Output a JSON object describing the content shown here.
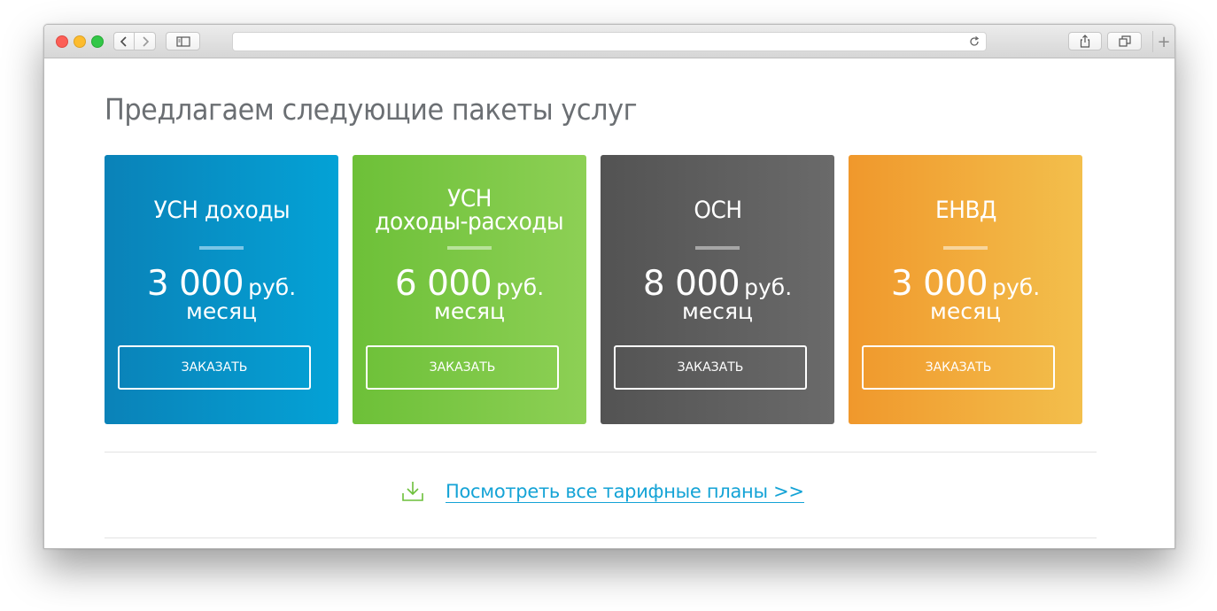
{
  "browser": {
    "url": "",
    "icons": {
      "back": "chevron-left-icon",
      "forward": "chevron-right-icon",
      "sidebar": "sidebar-icon",
      "reload": "reload-icon",
      "share": "share-icon",
      "tabs": "tabs-overview-icon",
      "new_tab": "plus-icon"
    }
  },
  "page": {
    "heading": "Предлагаем следующие пакеты услуг",
    "plans": [
      {
        "title_lines": [
          "УСН доходы"
        ],
        "amount": "3 000",
        "currency": "руб.",
        "period": "месяц",
        "button": "ЗАКАЗАТЬ",
        "color": "#0a82b8"
      },
      {
        "title_lines": [
          "УСН",
          "доходы-расходы"
        ],
        "amount": "6 000",
        "currency": "руб.",
        "period": "месяц",
        "button": "ЗАКАЗАТЬ",
        "color": "#6dc038"
      },
      {
        "title_lines": [
          "ОСН"
        ],
        "amount": "8 000",
        "currency": "руб.",
        "period": "месяц",
        "button": "ЗАКАЗАТЬ",
        "color": "#535353"
      },
      {
        "title_lines": [
          "ЕНВД"
        ],
        "amount": "3 000",
        "currency": "руб.",
        "period": "месяц",
        "button": "ЗАКАЗАТЬ",
        "color": "#f0982c"
      }
    ],
    "all_plans_link": "Посмотреть все тарифные планы >>",
    "all_plans_icon": "download-icon",
    "link_color": "#14a3d6"
  }
}
